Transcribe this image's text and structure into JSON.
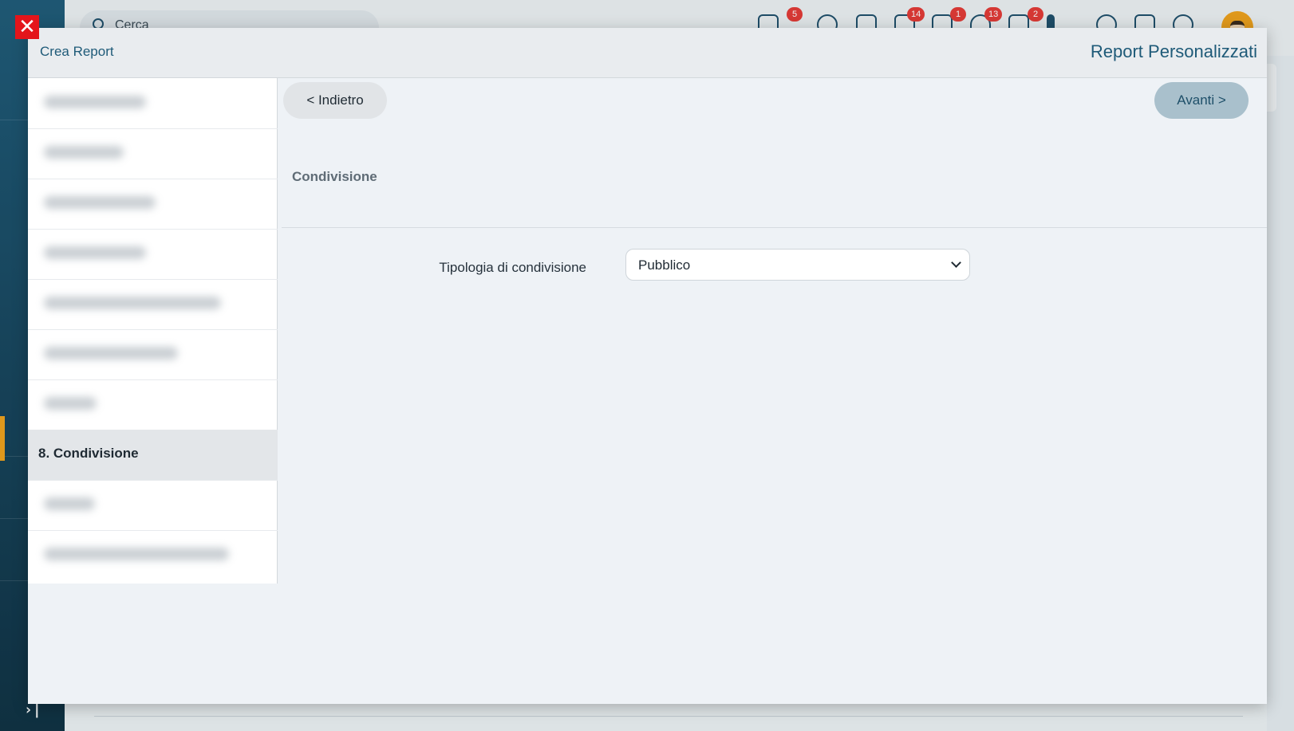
{
  "background": {
    "search_placeholder": "Cerca",
    "badges": [
      "5",
      "14",
      "1",
      "13",
      "2"
    ],
    "top_icons": [
      "network-icon",
      "history-icon",
      "calendar-icon",
      "mail-icon",
      "chat-icon",
      "bell-icon",
      "task-icon",
      "pin-icon",
      "star-icon",
      "document-icon",
      "timer-icon"
    ],
    "expand_glyph": "›|"
  },
  "modal": {
    "close_glyph": "✕",
    "title_left": "Crea Report",
    "title_right": "Report Personalizzati",
    "back_label": "< Indietro",
    "next_label": "Avanti >",
    "section_title": "Condivisione",
    "form": {
      "label": "Tipologia di condivisione",
      "selected": "Pubblico"
    },
    "steps": [
      {
        "label": "",
        "blurred": true
      },
      {
        "label": "",
        "blurred": true
      },
      {
        "label": "",
        "blurred": true
      },
      {
        "label": "",
        "blurred": true
      },
      {
        "label": "",
        "blurred": true
      },
      {
        "label": "",
        "blurred": true
      },
      {
        "label": "",
        "blurred": true
      },
      {
        "label": "8. Condivisione",
        "blurred": false,
        "active": true
      },
      {
        "label": "",
        "blurred": true
      },
      {
        "label": "",
        "blurred": true
      }
    ]
  },
  "colors": {
    "accent": "#1e5a78",
    "close": "#e4151b",
    "badge": "#e53935",
    "sidebar_active": "#f0a11b"
  }
}
